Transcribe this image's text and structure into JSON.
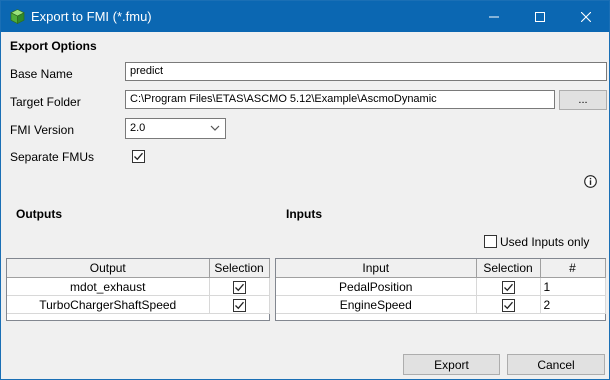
{
  "window": {
    "title": "Export to FMI (*.fmu)",
    "icon": "green-cube-app-icon",
    "controls": [
      "minimize-icon",
      "maximize-icon",
      "close-icon"
    ]
  },
  "export_options": {
    "heading": "Export Options",
    "base_name_label": "Base Name",
    "base_name_value": "predict",
    "target_folder_label": "Target Folder",
    "target_folder_value": "C:\\Program Files\\ETAS\\ASCMO 5.12\\Example\\AscmoDynamic",
    "browse_label": "...",
    "fmi_version_label": "FMI Version",
    "fmi_version_value": "2.0",
    "separate_fmus_label": "Separate FMUs",
    "separate_fmus_checked": true
  },
  "outputs": {
    "heading": "Outputs",
    "columns": [
      "Output",
      "Selection"
    ],
    "rows": [
      {
        "name": "mdot_exhaust",
        "selected": true
      },
      {
        "name": "TurboChargerShaftSpeed",
        "selected": true
      }
    ]
  },
  "inputs": {
    "heading": "Inputs",
    "used_inputs_only_label": "Used Inputs only",
    "used_inputs_only_checked": false,
    "columns": [
      "Input",
      "Selection",
      "#"
    ],
    "rows": [
      {
        "name": "PedalPosition",
        "selected": true,
        "index": "1"
      },
      {
        "name": "EngineSpeed",
        "selected": true,
        "index": "2"
      }
    ]
  },
  "footer": {
    "export_label": "Export",
    "cancel_label": "Cancel"
  },
  "colors": {
    "titlebar": "#0b67b2",
    "dialog_background": "#f0f0f0"
  }
}
